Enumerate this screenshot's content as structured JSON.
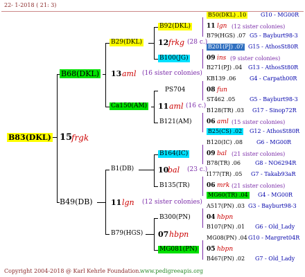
{
  "header": {
    "date": "22-  1-2018 ( 21:  3)"
  },
  "footer": {
    "copyright": "Copyright 2004-2018 @ Karl Kehrle Foundation.",
    "url": "www.pedigreeapis.org"
  },
  "root": {
    "id": "B83(DKL)",
    "num": "15",
    "line": "frgk"
  },
  "l1": [
    {
      "id": "B68(DKL)",
      "num": "13",
      "line": "aml",
      "note": "(16 sister colonies)"
    },
    {
      "id": "B49(DB)",
      "num": "11",
      "line": "lgn",
      "note": "(12 sister colonies)"
    }
  ],
  "l2": [
    {
      "id": "B29(DKL)",
      "num": "12",
      "line": "frkg",
      "note": "(28 c.)"
    },
    {
      "id": "Ca150(AM)",
      "num": "11",
      "line": "aml",
      "note": "(16 c.)"
    },
    {
      "id": "B1(DB)",
      "num": "10",
      "line": "bal",
      "note": "(23 c.)"
    },
    {
      "id": "B79(HGS)",
      "num": "07",
      "line": "hbpn",
      "note": ""
    }
  ],
  "l3": [
    {
      "id": "B92(DKL)",
      "num": "11",
      "line": "lgn",
      "note": "(12 sister colonies)"
    },
    {
      "id": "B100(JG)",
      "num": "09",
      "line": "ins",
      "note": "(9 sister colonies)"
    },
    {
      "id": "PS704",
      "num": "08",
      "line": "fun",
      "note": ""
    },
    {
      "id": "B121(AM)",
      "num": "06",
      "line": "aml",
      "note": "(15 sister colonies)"
    },
    {
      "id": "B164(IC)",
      "num": "09",
      "line": "bal",
      "note": "(21 sister colonies)"
    },
    {
      "id": "B135(TR)",
      "num": "06",
      "line": "mrk",
      "note": "(21 sister colonies)"
    },
    {
      "id": "B300(PN)",
      "num": "04",
      "line": "hbpn",
      "note": ""
    },
    {
      "id": "MG081(PN)",
      "num": "05",
      "line": "hbpn",
      "note": ""
    }
  ],
  "l4": [
    {
      "id": "B50(DKL) .10",
      "g": "G10 - MG00R"
    },
    {
      "id": "B79(HGS) .07",
      "g": "G5 - Bayburt98-3"
    },
    {
      "id": "B201(PJ) .07",
      "g": "G15 - AthosSt80R"
    },
    {
      "id": "B271(PJ) .04",
      "g": "G13 - AthosSt80R"
    },
    {
      "id": "KB139 .06",
      "g": "G4 - Carpath00R"
    },
    {
      "id": "ST462 .05",
      "g": "G5 - Bayburt98-3"
    },
    {
      "id": "B128(TR) .03",
      "g": "G17 - Sinop72R"
    },
    {
      "id": "B25(CS) .02",
      "g": "G12 - AthosSt80R"
    },
    {
      "id": "B120(IC) .08",
      "g": "G6 - MG00R"
    },
    {
      "id": "B78(TR) .06",
      "g": "G8 - NO6294R"
    },
    {
      "id": "I177(TR) .05",
      "g": "G7 - Takab93aR"
    },
    {
      "id": "MG60(TR) .04",
      "g": "G4 - MG00R"
    },
    {
      "id": "A517(PN) .03",
      "g": "G3 - Bayburt98-3"
    },
    {
      "id": "B107(PN) .01",
      "g": "G6 - Old_Lady"
    },
    {
      "id": "MG08(PN) .04",
      "g": "G10 - Margret04R"
    },
    {
      "id": "B467(PN) .02",
      "g": "G7 - Old_Lady"
    }
  ],
  "colors": {
    "yellow": "#ffff00",
    "green": "#00e000",
    "cyan": "#00e0ff",
    "blue": "#3070c0",
    "red": "#cc0000",
    "purple": "#7a2aa8"
  }
}
